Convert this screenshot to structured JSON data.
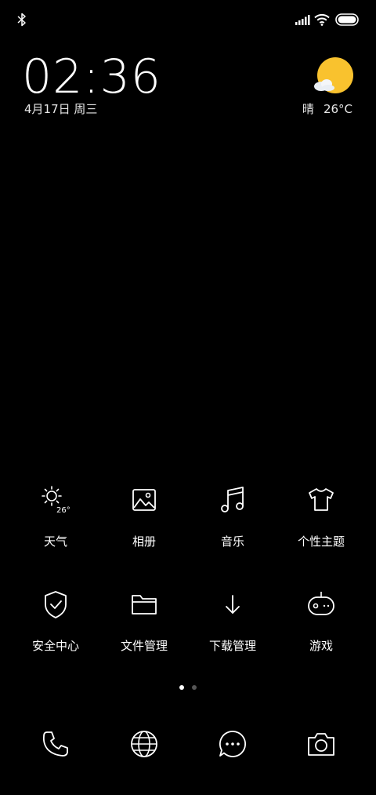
{
  "status_bar": {
    "icons": [
      "bluetooth-icon",
      "cellular-signal-icon",
      "wifi-icon",
      "battery-icon"
    ]
  },
  "clock_widget": {
    "time": "02:36",
    "date": "4月17日 周三"
  },
  "weather_widget": {
    "icon": "sun-cloud-icon",
    "condition": "晴",
    "temperature": "26°C",
    "sun_color": "#F9C22E"
  },
  "apps_row_1": [
    {
      "label": "天气",
      "icon": "weather-icon",
      "icon_text": "26°"
    },
    {
      "label": "相册",
      "icon": "gallery-icon"
    },
    {
      "label": "音乐",
      "icon": "music-icon"
    },
    {
      "label": "个性主题",
      "icon": "theme-shirt-icon"
    }
  ],
  "apps_row_2": [
    {
      "label": "安全中心",
      "icon": "security-shield-icon"
    },
    {
      "label": "文件管理",
      "icon": "folder-icon"
    },
    {
      "label": "下载管理",
      "icon": "download-icon"
    },
    {
      "label": "游戏",
      "icon": "game-controller-icon"
    }
  ],
  "page_indicator": {
    "pages": 2,
    "current": 1
  },
  "dock": [
    {
      "icon": "phone-icon"
    },
    {
      "icon": "browser-globe-icon"
    },
    {
      "icon": "messages-icon"
    },
    {
      "icon": "camera-icon"
    }
  ],
  "colors": {
    "background": "#000000",
    "foreground": "#FFFFFF",
    "dot_inactive": "#555555"
  }
}
